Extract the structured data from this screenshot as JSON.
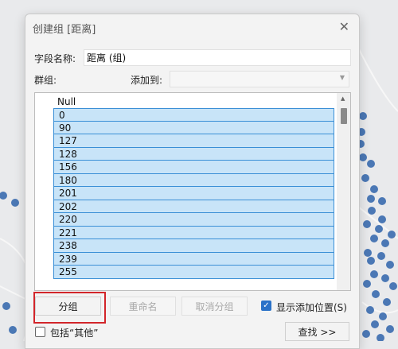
{
  "dialog": {
    "title": "创建组 [距离]",
    "close_icon": "close-icon"
  },
  "field_name": {
    "label": "字段名称:",
    "value": "距离 (组)"
  },
  "group_label": "群组:",
  "add_to": {
    "label": "添加到:",
    "value": "",
    "chevron_icon": "chevron-down-icon"
  },
  "list": {
    "null_item": "Null",
    "items": [
      "0",
      "90",
      "127",
      "128",
      "156",
      "180",
      "201",
      "202",
      "220",
      "221",
      "238",
      "239",
      "255"
    ]
  },
  "buttons": {
    "group": "分组",
    "rename": "重命名",
    "ungroup": "取消分组",
    "find": "查找 >>"
  },
  "checkboxes": {
    "show_add_position": {
      "label": "显示添加位置(S)",
      "checked": true
    },
    "include_other": {
      "label": "包括“其他”",
      "checked": false
    }
  },
  "colors": {
    "selection_fill": "#c8e4f8",
    "selection_border": "#3a8fd6",
    "highlight_frame": "#d2252a",
    "map_dot": "#4b78b5"
  }
}
